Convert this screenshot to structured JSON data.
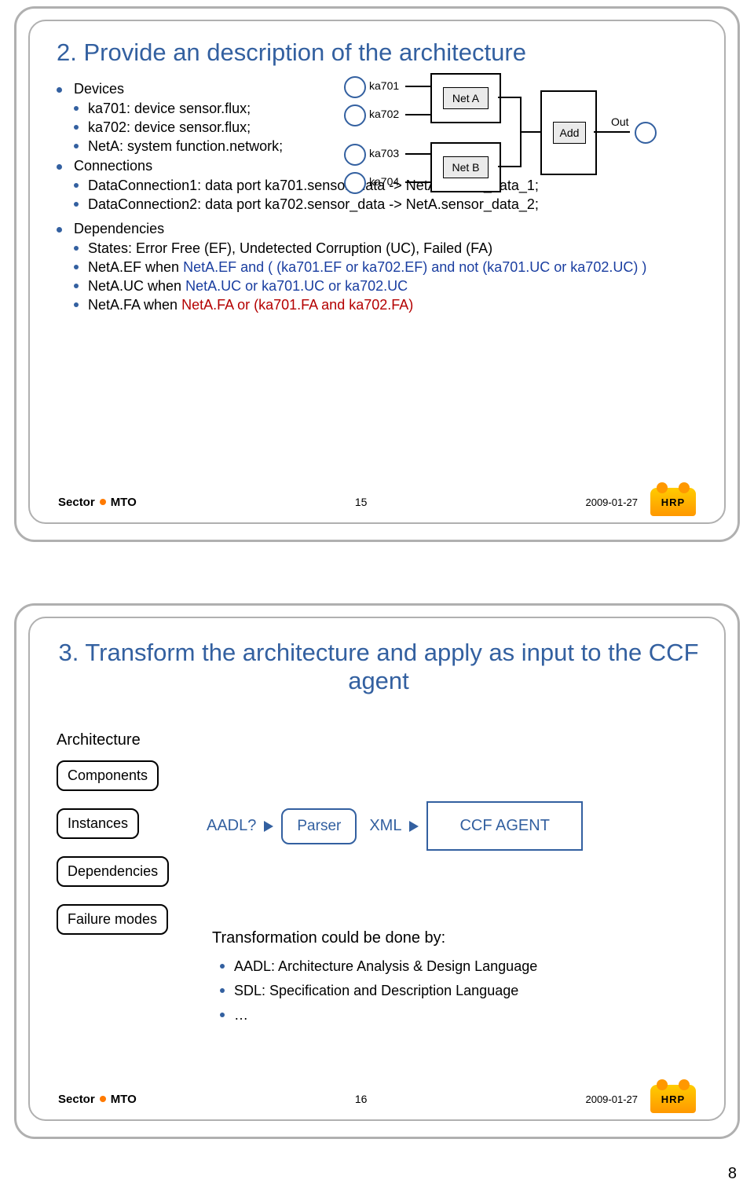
{
  "page_number": "8",
  "slide1": {
    "title": "2. Provide an description of the architecture",
    "devices_h": "Devices",
    "devices": [
      "ka701: device sensor.flux;",
      "ka702: device sensor.flux;",
      "NetA: system function.network;"
    ],
    "connections_h": "Connections",
    "connections": [
      "DataConnection1: data port ka701.sensor_data -> NetA.sensor_data_1;",
      "DataConnection2: data port ka702.sensor_data -> NetA.sensor_data_2;"
    ],
    "deps_h": "Dependencies",
    "deps_states": "States: Error Free (EF), Undetected Corruption (UC), Failed (FA)",
    "dep1_p": "NetA.EF when",
    "dep1_b": " NetA.EF and ( (ka701.EF or ka702.EF) and not (ka701.UC or ka702.UC) )",
    "dep2_p": "NetA.UC when",
    "dep2_b": " NetA.UC or ka701.UC or ka702.UC",
    "dep3_p": "NetA.FA when",
    "dep3_r": " NetA.FA or (ka701.FA and ka702.FA)",
    "diagram": {
      "ka701": "ka701",
      "ka702": "ka702",
      "ka703": "ka703",
      "ka704": "ka704",
      "netA": "Net A",
      "netB": "Net B",
      "add": "Add",
      "out": "Out"
    },
    "footer_sector": "Sector",
    "footer_mto": "MTO",
    "footer_page": "15",
    "footer_date": "2009-01-27",
    "logo": "HRP"
  },
  "slide2": {
    "title": "3. Transform the architecture and apply as input to the CCF agent",
    "arch_label": "Architecture",
    "pills": [
      "Components",
      "Instances",
      "Dependencies",
      "Failure modes"
    ],
    "flow": {
      "aadl": "AADL?",
      "parser": "Parser",
      "xml": "XML",
      "agent": "CCF AGENT"
    },
    "transf_h": "Transformation could be done by:",
    "transf_items": [
      "AADL: Architecture Analysis & Design Language",
      "SDL: Specification and Description Language",
      "…"
    ],
    "footer_sector": "Sector",
    "footer_mto": "MTO",
    "footer_page": "16",
    "footer_date": "2009-01-27",
    "logo": "HRP"
  }
}
